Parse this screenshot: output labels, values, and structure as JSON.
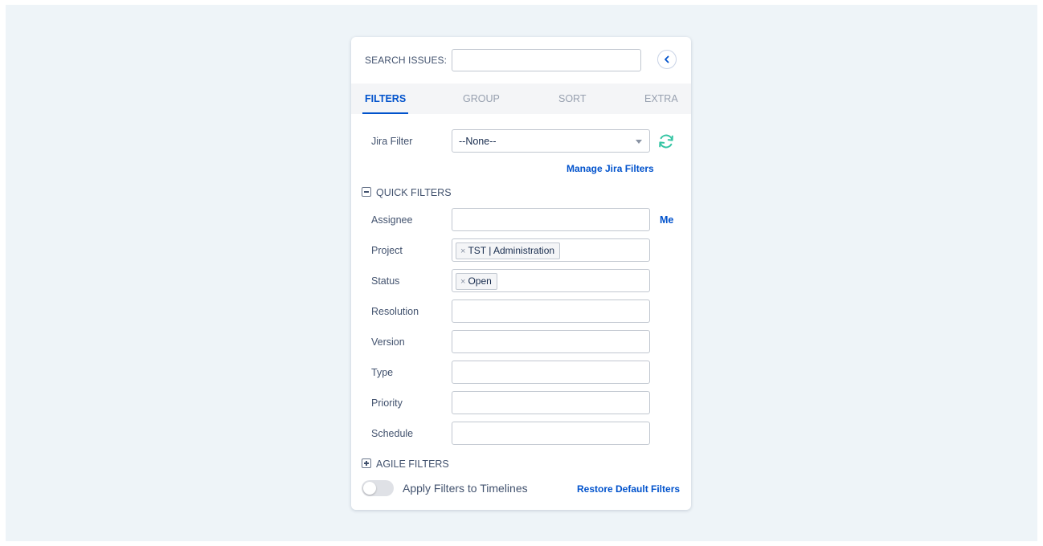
{
  "search": {
    "label": "SEARCH ISSUES:",
    "value": "",
    "placeholder": ""
  },
  "tabs": [
    {
      "label": "FILTERS",
      "active": true
    },
    {
      "label": "GROUP",
      "active": false
    },
    {
      "label": "SORT",
      "active": false
    },
    {
      "label": "EXTRA",
      "active": false
    }
  ],
  "jira_filter": {
    "label": "Jira Filter",
    "value": "--None--",
    "manage_link": "Manage Jira Filters"
  },
  "quick_filters": {
    "title": "QUICK FILTERS",
    "assignee_label": "Assignee",
    "assignee_me_link": "Me",
    "project_label": "Project",
    "project_tags": [
      "TST | Administration"
    ],
    "status_label": "Status",
    "status_tags": [
      "Open"
    ],
    "resolution_label": "Resolution",
    "version_label": "Version",
    "type_label": "Type",
    "priority_label": "Priority",
    "schedule_label": "Schedule"
  },
  "agile_filters": {
    "title": "AGILE FILTERS"
  },
  "footer": {
    "toggle_label": "Apply Filters to Timelines",
    "toggle_on": false,
    "restore_link": "Restore Default Filters"
  },
  "icons": {
    "collapse": "chevron-left-icon",
    "refresh": "refresh-icon",
    "quick_toggle": "minus-square-icon",
    "agile_toggle": "plus-square-icon",
    "tag_remove": "close-icon"
  },
  "colors": {
    "accent": "#0052cc",
    "refresh": "#36c5a4",
    "background": "#eef4f8"
  }
}
